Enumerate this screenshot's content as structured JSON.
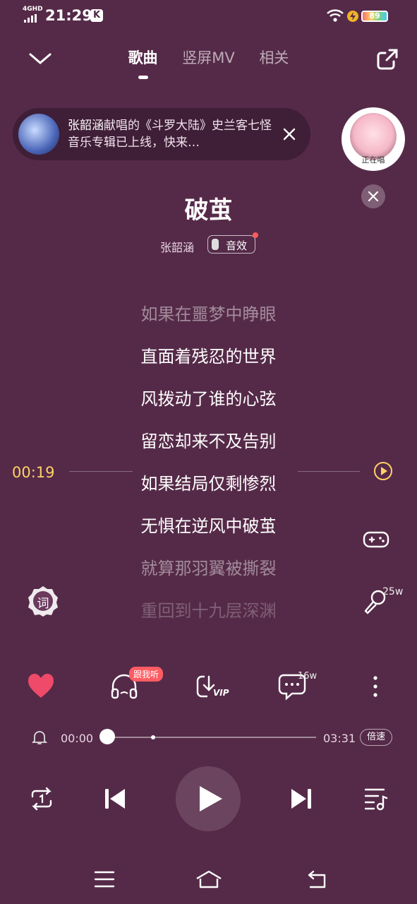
{
  "status_bar": {
    "time": "21:29",
    "network": "4GHD",
    "battery": "89",
    "app_badge": "K"
  },
  "header": {
    "tabs": [
      {
        "label": "歌曲",
        "active": true
      },
      {
        "label": "竖屏MV",
        "active": false
      },
      {
        "label": "相关",
        "active": false
      }
    ]
  },
  "banner": {
    "text_highlight": "张韶涵",
    "text_rest": "献唱的《斗罗大陆》史兰客七怪音乐专辑已上线，快来…"
  },
  "avatar": {
    "label": "正在唱"
  },
  "song": {
    "title": "破茧",
    "artist": "张韶涵",
    "effect_label": "音效"
  },
  "lyrics": [
    {
      "text": "如果在噩梦中睁眼",
      "state": "dim"
    },
    {
      "text": "直面着残忍的世界",
      "state": "normal"
    },
    {
      "text": "风拨动了谁的心弦",
      "state": "normal"
    },
    {
      "text": "留恋却来不及告别",
      "state": "normal"
    },
    {
      "text": "如果结局仅剩惨烈",
      "state": "normal"
    },
    {
      "text": "无惧在逆风中破茧",
      "state": "normal"
    },
    {
      "text": "就算那羽翼被撕裂",
      "state": "dim"
    },
    {
      "text": "重回到十九层深渊",
      "state": "faint"
    }
  ],
  "lyric_seek_time": "00:19",
  "side_actions": {
    "lyric_icon_label": "词",
    "sing_count": "25w"
  },
  "actions": {
    "follow_badge": "跟我听",
    "comment_count": "16w",
    "vip_label": "VIP"
  },
  "progress": {
    "current": "00:00",
    "total": "03:31",
    "speed_label": "倍速",
    "fraction": 0.0
  },
  "colors": {
    "background": "#552a48",
    "accent_time": "#ffd166",
    "heart": "#ef4a6a"
  }
}
